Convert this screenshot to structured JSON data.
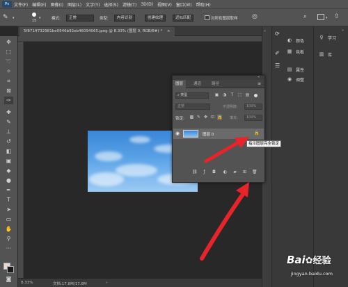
{
  "menubar": {
    "logo": "Ps",
    "items": [
      "文件(F)",
      "编辑(E)",
      "图像(I)",
      "图层(L)",
      "文字(Y)",
      "选择(S)",
      "滤镜(T)",
      "3D(D)",
      "视图(V)",
      "窗口(W)",
      "帮助(H)"
    ]
  },
  "options": {
    "brush_size": "15",
    "mode_label": "模式:",
    "mode_value": "正常",
    "type_label": "类型:",
    "btn_content": "内容识别",
    "btn_texture": "创建纹理",
    "btn_proximity": "近似匹配",
    "sample_all": "对所有图层取样"
  },
  "document": {
    "tab_title": "5f871ff732981be0946b92eb46094065.jpeg @ 8.33% (图层 0, RGB/8#) *",
    "zoom": "8.33%",
    "doc_size": "文档:17.8M/17.8M"
  },
  "dock": {
    "color": "颜色",
    "swatches": "色板",
    "properties": "属性",
    "adjustments": "调整",
    "learn": "学习",
    "libraries": "库"
  },
  "layers_panel": {
    "tabs": [
      "图层",
      "通道",
      "路径"
    ],
    "filter_kind": "类型",
    "blend_mode": "正常",
    "opacity_label": "不透明度:",
    "opacity_value": "100%",
    "lock_label": "锁定:",
    "fill_label": "填充:",
    "fill_value": "100%",
    "layer_name": "图层 0"
  },
  "tooltip": "指示图层完全锁定",
  "watermark": {
    "brand": "Bai",
    "brand2": "经验",
    "url": "jingyan.baidu.com"
  },
  "colors": {
    "arrow": "#e8242a",
    "accent": "#1473e6"
  }
}
